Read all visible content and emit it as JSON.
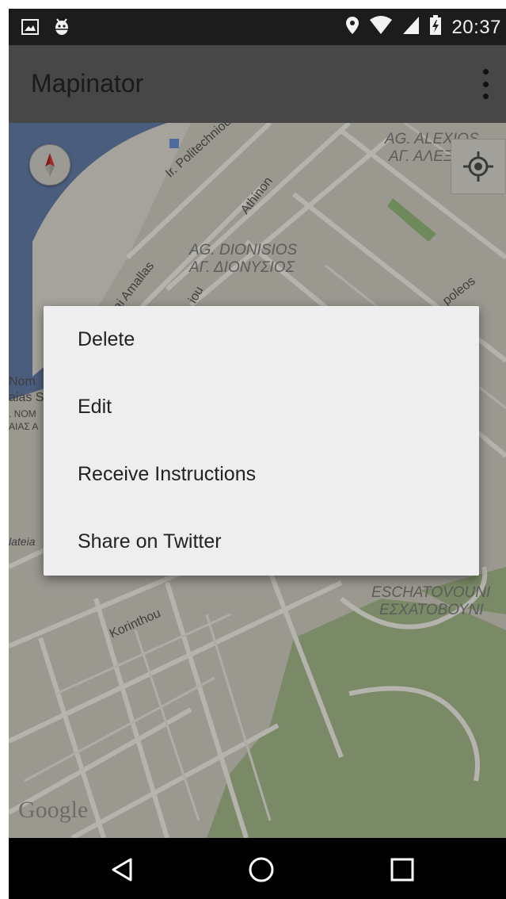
{
  "status_bar": {
    "time": "20:37",
    "left_icons": [
      "image-icon",
      "android-debug-icon"
    ],
    "right_icons": [
      "location-pin-icon",
      "wifi-icon",
      "signal-icon",
      "battery-charging-icon"
    ]
  },
  "app_bar": {
    "title": "Mapinator",
    "menu_icon": "overflow-menu-icon"
  },
  "map": {
    "street_labels": {
      "politechniou": "Ir. Politechniou",
      "athinon": "Athinon",
      "amallas": "kai Amallas",
      "korinthou": "Korinthou",
      "poleos": "poleos",
      "iou": "iou",
      "plateia": "lateia"
    },
    "area_labels": {
      "dionisios_latin": "AG. DIONISIOS",
      "dionisios_greek": "ΑΓ. ΔΙΟΝΥΣΙΟΣ",
      "alexios_latin": "AG. ALEXIOS",
      "alexios_greek": "ΑΓ. ΑΛΕΞΙΟΣ",
      "eschatovouni_latin": "ESCHATOVOUNI",
      "eschatovouni_greek": "ΕΣΧΑΤΟΒΟΥΝΙ"
    },
    "cut_labels": [
      "Nom",
      "aias S",
      ". NOM",
      "ΑΙΑΣ Α"
    ],
    "attribution": "Google",
    "controls": {
      "compass_icon": "compass-icon",
      "locate_icon": "my-location-icon"
    }
  },
  "context_menu": {
    "items": [
      {
        "label": "Delete"
      },
      {
        "label": "Edit"
      },
      {
        "label": "Receive Instructions"
      },
      {
        "label": "Share on Twitter"
      }
    ]
  },
  "nav_bar": {
    "buttons": [
      "back-icon",
      "home-icon",
      "recents-icon"
    ]
  },
  "colors": {
    "status_bar": "#1c1c1c",
    "app_bar": "#474747",
    "map_dimmed": "#9b9890",
    "water": "#4a5d7c",
    "park": "#7a8a66",
    "dialog": "#eeeeee"
  }
}
